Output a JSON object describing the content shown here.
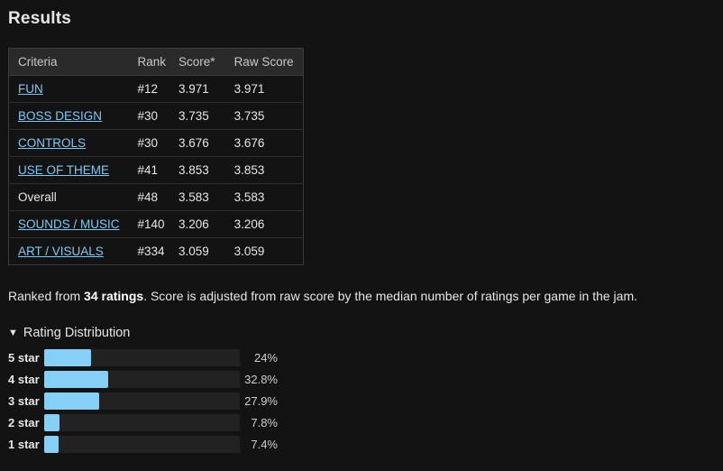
{
  "results": {
    "title": "Results",
    "table": {
      "headers": [
        "Criteria",
        "Rank",
        "Score*",
        "Raw Score"
      ],
      "rows": [
        {
          "criteria": "FUN",
          "rank": "#12",
          "score": "3.971",
          "raw": "3.971",
          "link": true
        },
        {
          "criteria": "BOSS DESIGN",
          "rank": "#30",
          "score": "3.735",
          "raw": "3.735",
          "link": true
        },
        {
          "criteria": "CONTROLS",
          "rank": "#30",
          "score": "3.676",
          "raw": "3.676",
          "link": true
        },
        {
          "criteria": "USE OF THEME",
          "rank": "#41",
          "score": "3.853",
          "raw": "3.853",
          "link": true
        },
        {
          "criteria": "Overall",
          "rank": "#48",
          "score": "3.583",
          "raw": "3.583",
          "link": false
        },
        {
          "criteria": "SOUNDS / MUSIC",
          "rank": "#140",
          "score": "3.206",
          "raw": "3.206",
          "link": true
        },
        {
          "criteria": "ART / VISUALS",
          "rank": "#334",
          "score": "3.059",
          "raw": "3.059",
          "link": true
        }
      ]
    },
    "summary": {
      "prefix": "Ranked from ",
      "count": "34 ratings",
      "suffix": ". Score is adjusted from raw score by the median number of ratings per game in the jam."
    },
    "distribution": {
      "toggle_label": "Rating Distribution",
      "toggle_symbol": "▼",
      "bar_color": "#86cff7",
      "rows": [
        {
          "label": "5 star",
          "pct_text": "24%",
          "pct": 24
        },
        {
          "label": "4 star",
          "pct_text": "32.8%",
          "pct": 32.8
        },
        {
          "label": "3 star",
          "pct_text": "27.9%",
          "pct": 27.9
        },
        {
          "label": "2 star",
          "pct_text": "7.8%",
          "pct": 7.8
        },
        {
          "label": "1 star",
          "pct_text": "7.4%",
          "pct": 7.4
        }
      ]
    }
  }
}
